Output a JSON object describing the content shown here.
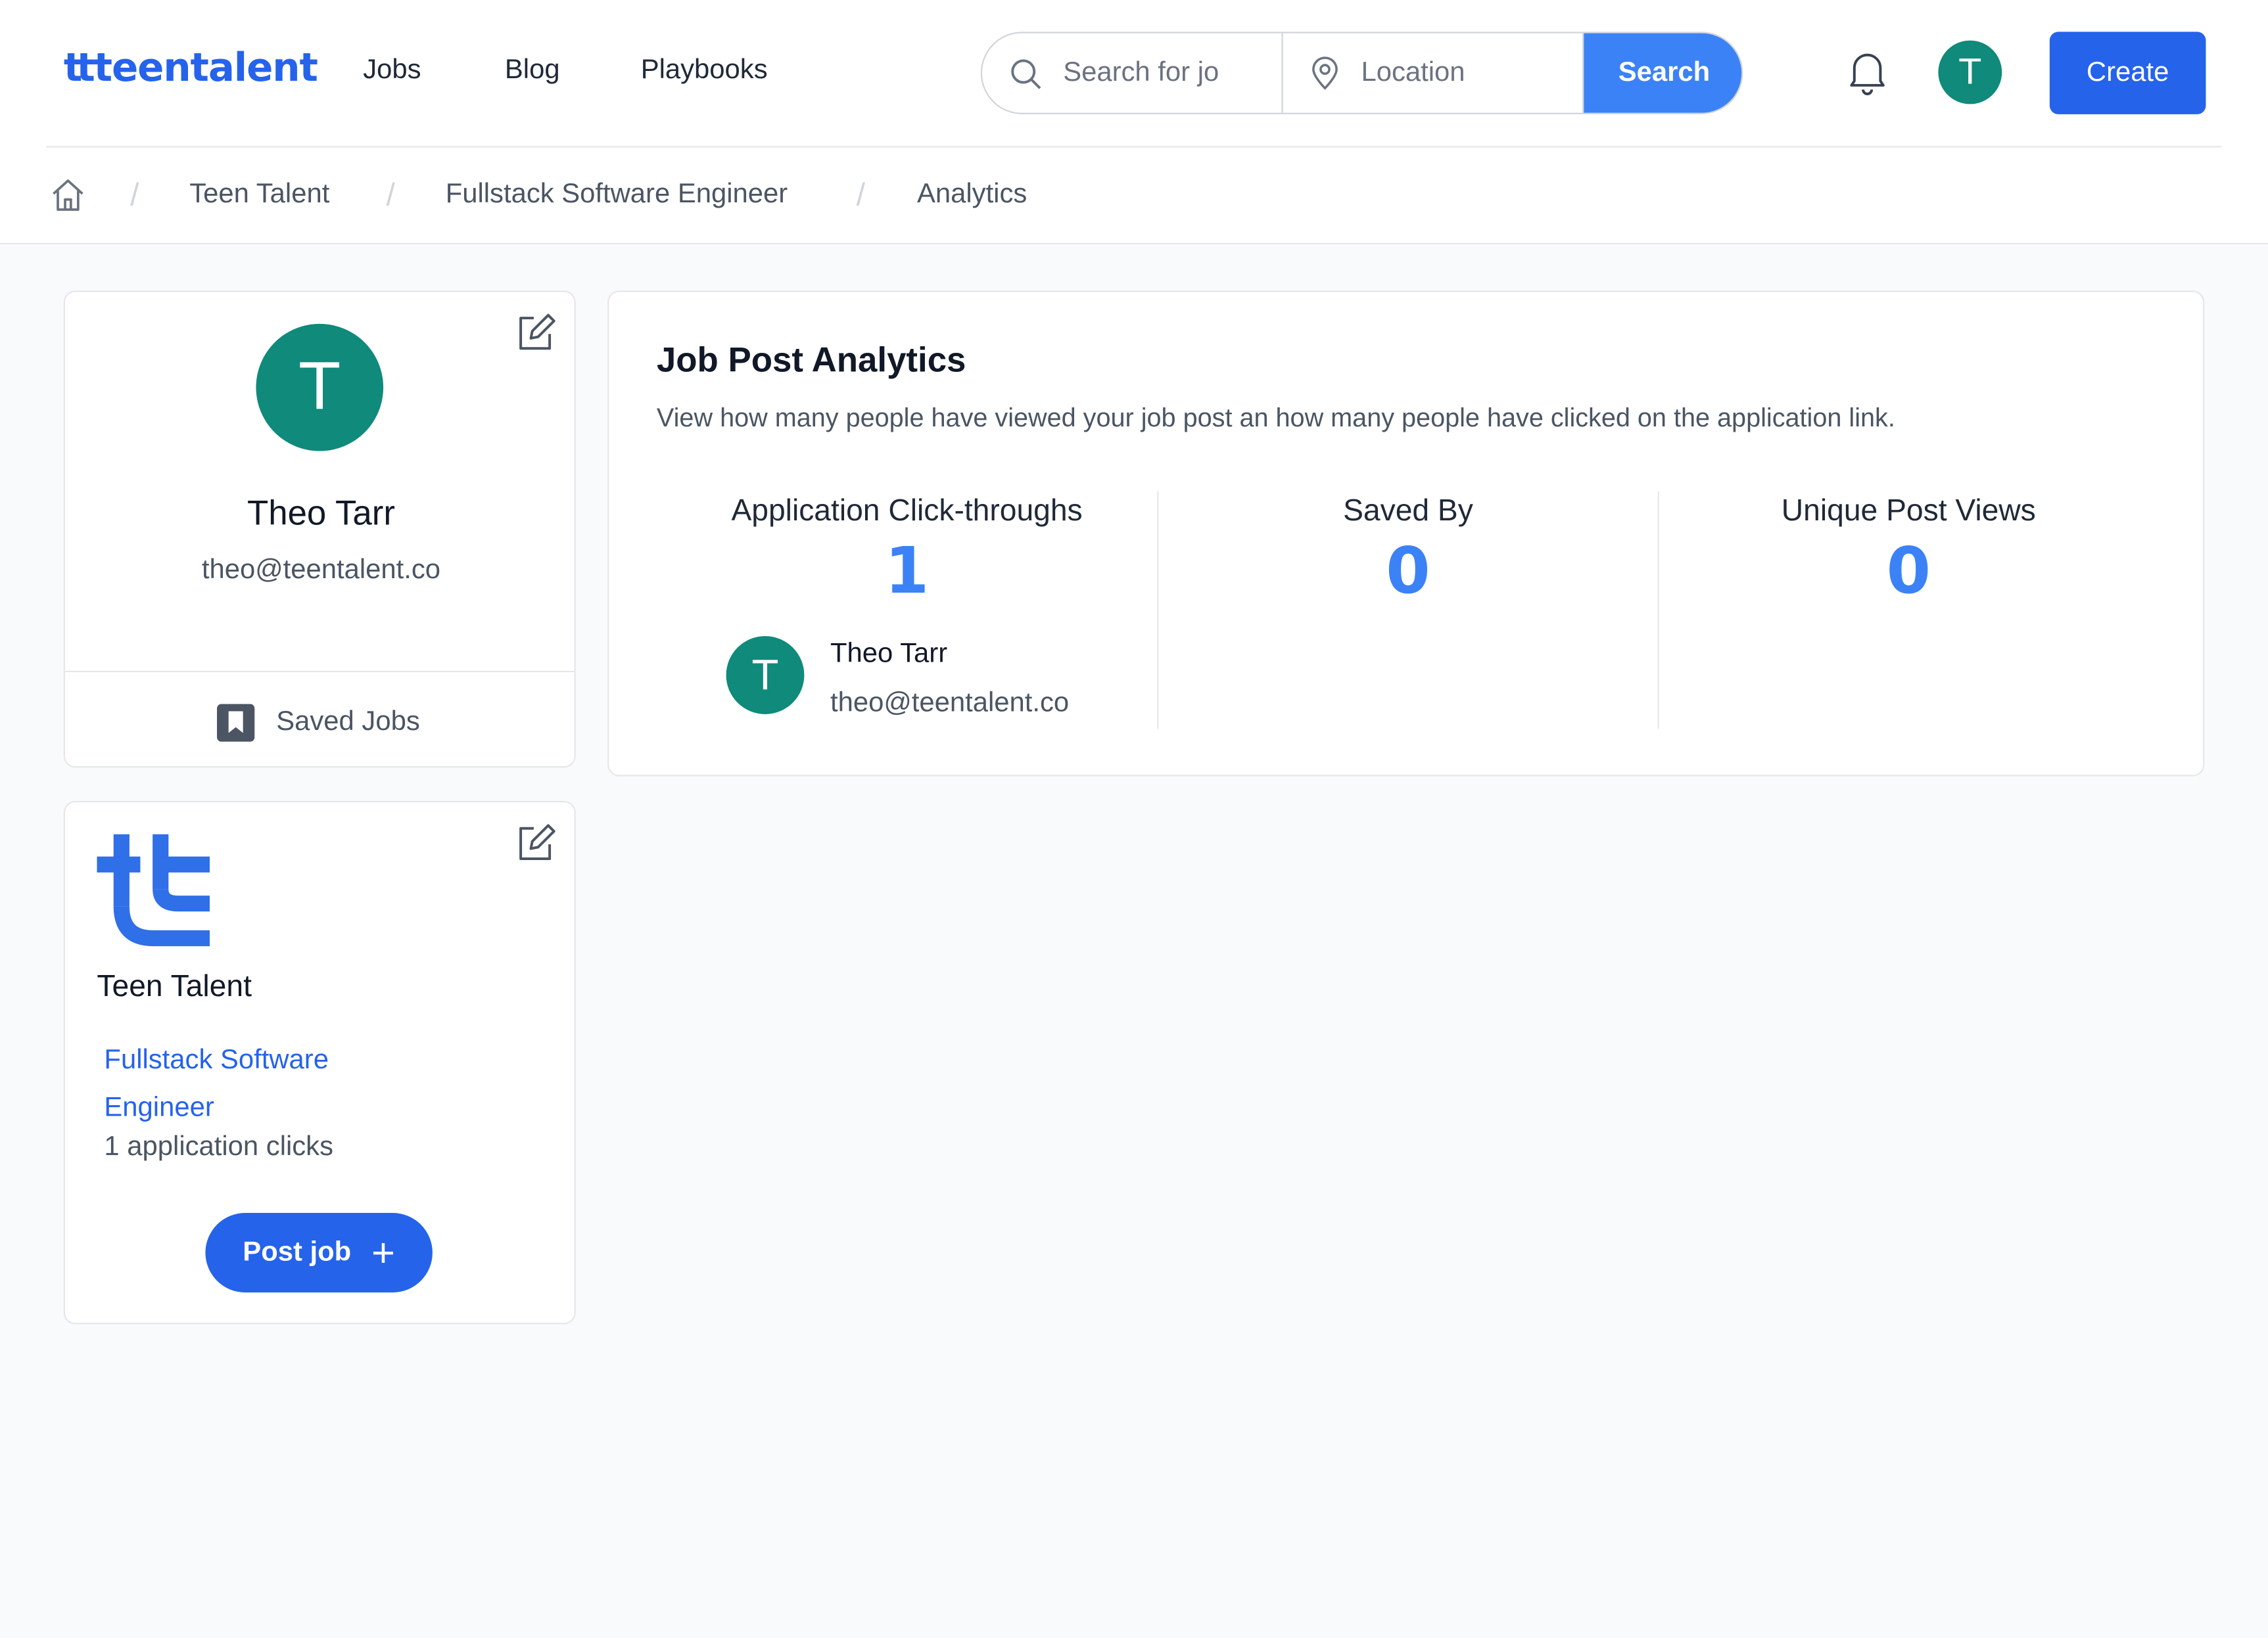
{
  "brand": {
    "logo_mark": "tt",
    "logo_text": "teentalent",
    "color": "#2563eb"
  },
  "nav": {
    "jobs": "Jobs",
    "blog": "Blog",
    "playbooks": "Playbooks"
  },
  "search": {
    "job_placeholder": "Search for jo",
    "location_placeholder": "Location",
    "button_label": "Search",
    "search_icon": "search-icon",
    "location_icon": "map-pin-icon"
  },
  "header": {
    "bell_icon": "bell-icon",
    "avatar_initial": "T",
    "create_label": "Create"
  },
  "breadcrumb": {
    "home_icon": "home-icon",
    "items": [
      "Teen Talent",
      "Fullstack Software Engineer",
      "Analytics"
    ],
    "separator": "/"
  },
  "profile": {
    "initial": "T",
    "name": "Theo Tarr",
    "email": "theo@teentalent.co",
    "saved_jobs_label": "Saved Jobs",
    "saved_icon": "bookmark-icon",
    "edit_icon": "pencil-square-icon"
  },
  "company": {
    "name": "Teen Talent",
    "job_title": "Fullstack Software Engineer",
    "clicks_text": "1 application clicks",
    "post_job_label": "Post job",
    "post_job_icon": "+"
  },
  "analytics": {
    "title": "Job Post Analytics",
    "description": "View how many people have viewed your job post an how many people have clicked on the application link.",
    "stats": [
      {
        "label": "Application Click-throughs",
        "value": "1"
      },
      {
        "label": "Saved By",
        "value": "0"
      },
      {
        "label": "Unique Post Views",
        "value": "0"
      }
    ],
    "clickers": [
      {
        "initial": "T",
        "name": "Theo Tarr",
        "email": "theo@teentalent.co"
      }
    ]
  },
  "colors": {
    "primary": "#2563eb",
    "accent": "#3b82f6",
    "avatar": "#0f8a7b",
    "background": "#f9fafb"
  }
}
